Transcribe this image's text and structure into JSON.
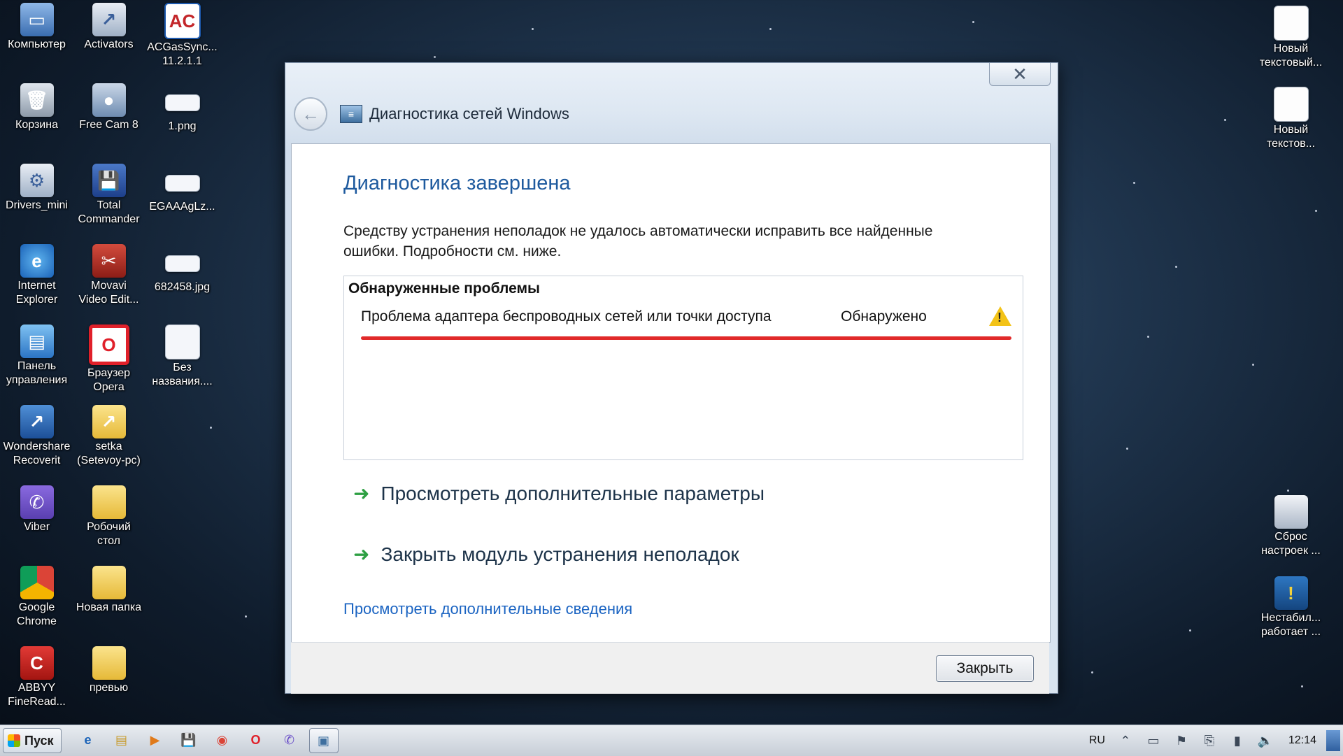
{
  "desktop": {
    "icons": [
      {
        "label": "Компьютер",
        "glyph": "▭",
        "icon": "computer-icon"
      },
      {
        "label": "Activators",
        "glyph": "↗",
        "icon": "activators-icon"
      },
      {
        "label": "ACGasSync...\n11.2.1.1",
        "glyph": "AC",
        "icon": "acgassync-icon"
      },
      {
        "label": "Корзина",
        "glyph": "🗑",
        "icon": "recycle-bin-icon"
      },
      {
        "label": "Free Cam 8",
        "glyph": "●",
        "icon": "freecam-icon"
      },
      {
        "label": "1.png",
        "glyph": "",
        "icon": "image-file-icon"
      },
      {
        "label": "Drivers_mini",
        "glyph": "⚙",
        "icon": "drivers-icon"
      },
      {
        "label": "Total\nCommander",
        "glyph": "💾",
        "icon": "total-commander-icon"
      },
      {
        "label": "EGAAAgLz...",
        "glyph": "",
        "icon": "image-file-icon"
      },
      {
        "label": "Internet\nExplorer",
        "glyph": "e",
        "icon": "internet-explorer-icon"
      },
      {
        "label": "Movavi\nVideo Edit...",
        "glyph": "✂",
        "icon": "movavi-icon"
      },
      {
        "label": "682458.jpg",
        "glyph": "",
        "icon": "image-file-icon"
      },
      {
        "label": "Панель\nуправления",
        "glyph": "▤",
        "icon": "control-panel-icon"
      },
      {
        "label": "Браузер\nOpera",
        "glyph": "O",
        "icon": "opera-icon"
      },
      {
        "label": "Без\nназвания....",
        "glyph": "",
        "icon": "image-file-icon"
      },
      {
        "label": "Wondershare\nRecoverit",
        "glyph": "↗",
        "icon": "wondershare-icon"
      },
      {
        "label": "setka\n(Setevoy-pc)",
        "glyph": "↗",
        "icon": "setka-icon"
      },
      {
        "label": "Viber",
        "glyph": "✆",
        "icon": "viber-icon"
      },
      {
        "label": "Робочий\nстол",
        "glyph": "",
        "icon": "folder-icon"
      },
      {
        "label": "Google\nChrome",
        "glyph": "",
        "icon": "chrome-icon"
      },
      {
        "label": "Новая папка",
        "glyph": "",
        "icon": "folder-icon"
      },
      {
        "label": "ABBYY\nFineRead...",
        "glyph": "C",
        "icon": "abbyy-icon"
      },
      {
        "label": "превью",
        "glyph": "",
        "icon": "folder-icon"
      },
      {
        "label": "Новый\nтекстовый...",
        "glyph": "",
        "icon": "text-file-icon"
      },
      {
        "label": "Новый\nтекстов...",
        "glyph": "",
        "icon": "text-file-icon"
      },
      {
        "label": "Сброс\nнастроек ...",
        "glyph": "",
        "icon": "reset-settings-icon"
      },
      {
        "label": "Нестабил...\nработает ...",
        "glyph": "!",
        "icon": "unstable-network-icon"
      }
    ]
  },
  "dialog": {
    "title": "Диагностика сетей Windows",
    "close_glyph": "✕",
    "back_glyph": "←",
    "heading": "Диагностика завершена",
    "description": "Средству устранения неполадок не удалось автоматически исправить все найденные\nошибки. Подробности см. ниже.",
    "problems": {
      "header": "Обнаруженные проблемы",
      "items": [
        {
          "name": "Проблема адаптера беспроводных сетей или точки доступа",
          "status": "Обнаружено",
          "icon": "warning-icon"
        }
      ]
    },
    "actions": [
      {
        "label": "Просмотреть дополнительные параметры",
        "icon": "green-arrow-icon"
      },
      {
        "label": "Закрыть модуль устранения неполадок",
        "icon": "green-arrow-icon"
      }
    ],
    "link": "Просмотреть дополнительные сведения",
    "close_button": "Закрыть"
  },
  "taskbar": {
    "start_label": "Пуск",
    "apps": [
      "e",
      "▤",
      "▶",
      "💾",
      "◉",
      "O",
      "✆",
      "▣"
    ],
    "language": "RU",
    "time": "12:14"
  },
  "colors": {
    "heading": "#1e5a9e",
    "link": "#1b64c2",
    "highlight_underline": "#e12a2a",
    "warning": "#f3c317",
    "action_arrow": "#2ea043"
  }
}
